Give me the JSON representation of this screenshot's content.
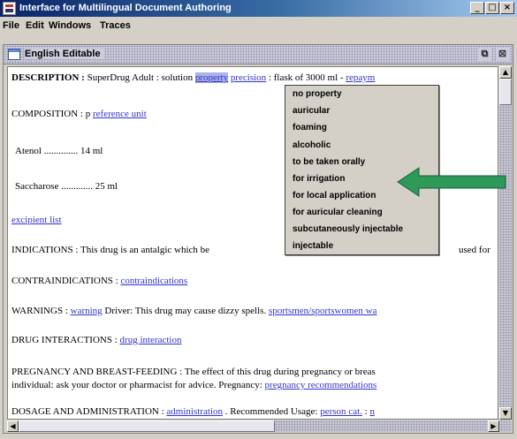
{
  "window": {
    "title": "Interface for Multilingual Document Authoring",
    "buttons": [
      "_",
      "□",
      "×"
    ]
  },
  "menu": [
    "File",
    "Edit",
    "Windows",
    "Traces"
  ],
  "frame": {
    "title": "English Editable",
    "buttons": [
      "⧉",
      "⊠"
    ]
  },
  "doc": {
    "description": {
      "label": "DESCRIPTION :",
      "brand": "SuperDrug",
      "age": "Adult :",
      "form": "solution",
      "property_link": "property",
      "precision_link": "precision",
      "flask": ": flask of 3000 ml -",
      "repaym_link": "repaym"
    },
    "composition": {
      "label": "COMPOSITION : p",
      "link": "reference unit"
    },
    "ingredients": [
      {
        "name": "Atenol",
        "dots": "..............",
        "amount": "14 ml"
      },
      {
        "name": "Saccharose",
        "dots": ".............",
        "amount": "25 ml"
      }
    ],
    "excipient_link": "excipient list",
    "indications": {
      "text": "INDICATIONS :  This drug is an antalgic which be",
      "tail": "used for"
    },
    "contraindications": {
      "label": "CONTRAINDICATIONS :",
      "link": "contraindications"
    },
    "warnings": {
      "label": "WARNINGS :",
      "link": "warning",
      "text": "Driver: This drug may cause dizzy spells.",
      "link2": "sportsmen/sportswomen wa"
    },
    "drug_interactions": {
      "label": "DRUG INTERACTIONS :",
      "link": "drug interaction"
    },
    "pregnancy": {
      "line1": "PREGNANCY AND BREAST-FEEDING :  The effect of this drug during pregnancy or breas",
      "line2": "individual: ask your doctor or pharmacist for advice. Pregnancy:",
      "link": "pregnancy recommendations"
    },
    "dosage": {
      "label": "DOSAGE AND ADMINISTRATION :",
      "link": "administration",
      "text": ". Recommended Usage:",
      "link2": "person cat.",
      "tail": ":",
      "link3": "n"
    }
  },
  "popup": {
    "items": [
      "no property",
      "auricular",
      "foaming",
      "alcoholic",
      "to be taken orally",
      "for irrigation",
      "for local  application",
      "for auricular cleaning",
      "subcutaneously injectable",
      "injectable"
    ]
  },
  "colors": {
    "link": "#3333cc",
    "arrow": "#2e9a5a",
    "title_bar": "#0a246a"
  }
}
